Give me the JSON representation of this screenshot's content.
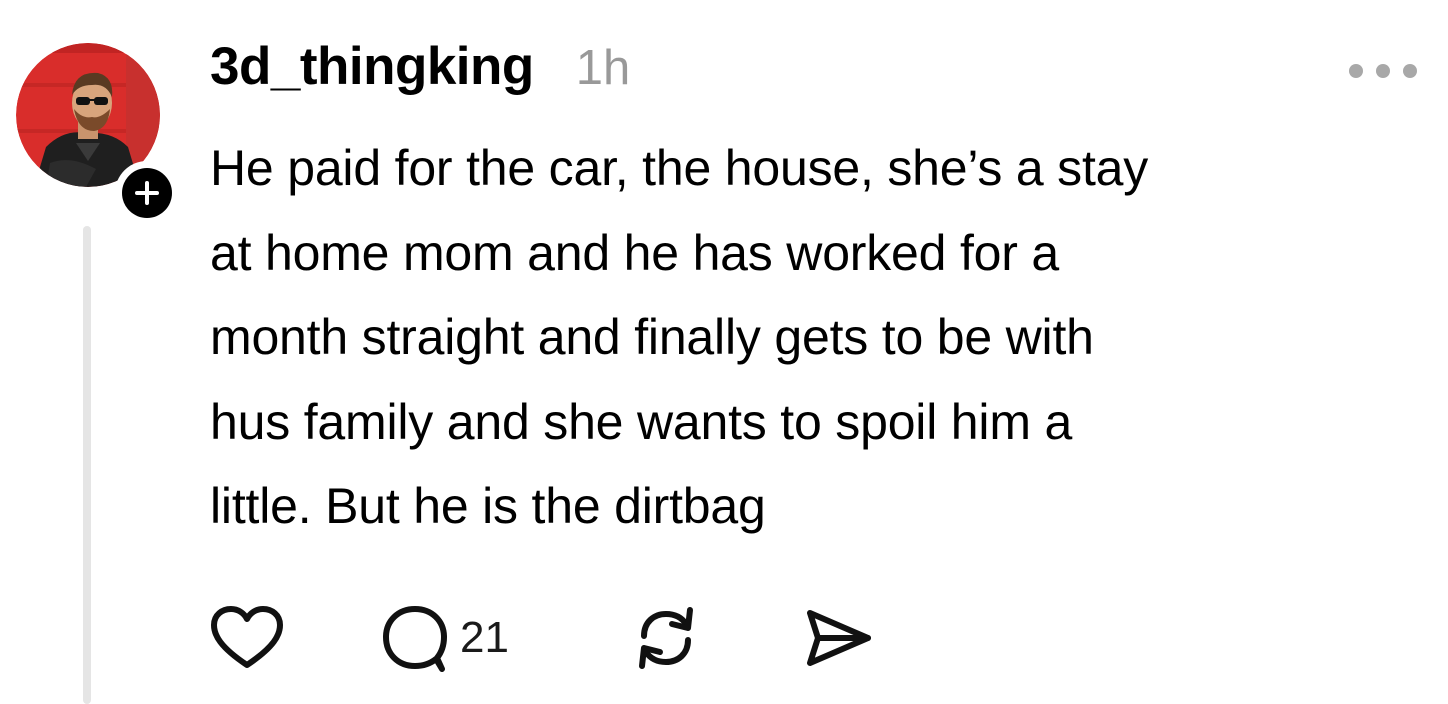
{
  "post": {
    "author": {
      "username": "3d_thingking",
      "avatar_icon": "profile-photo-man-sunglasses-red-wall",
      "follow_icon": "plus-icon"
    },
    "timestamp": "1h",
    "text": "He paid for the car, the house, she’s a stay\nat home mom and he has worked for a\nmonth straight and finally gets to be with\nhus family and she wants to spoil him a\nlittle. But he is the dirtbag",
    "actions": {
      "like_icon": "heart-icon",
      "reply_icon": "speech-bubble-icon",
      "reply_count": "21",
      "repost_icon": "repost-icon",
      "share_icon": "send-icon"
    },
    "more_icon": "ellipsis-icon"
  },
  "colors": {
    "text": "#000000",
    "muted": "#999999",
    "thread_line": "#e5e5e5",
    "avatar_background": "#d92d2b"
  }
}
